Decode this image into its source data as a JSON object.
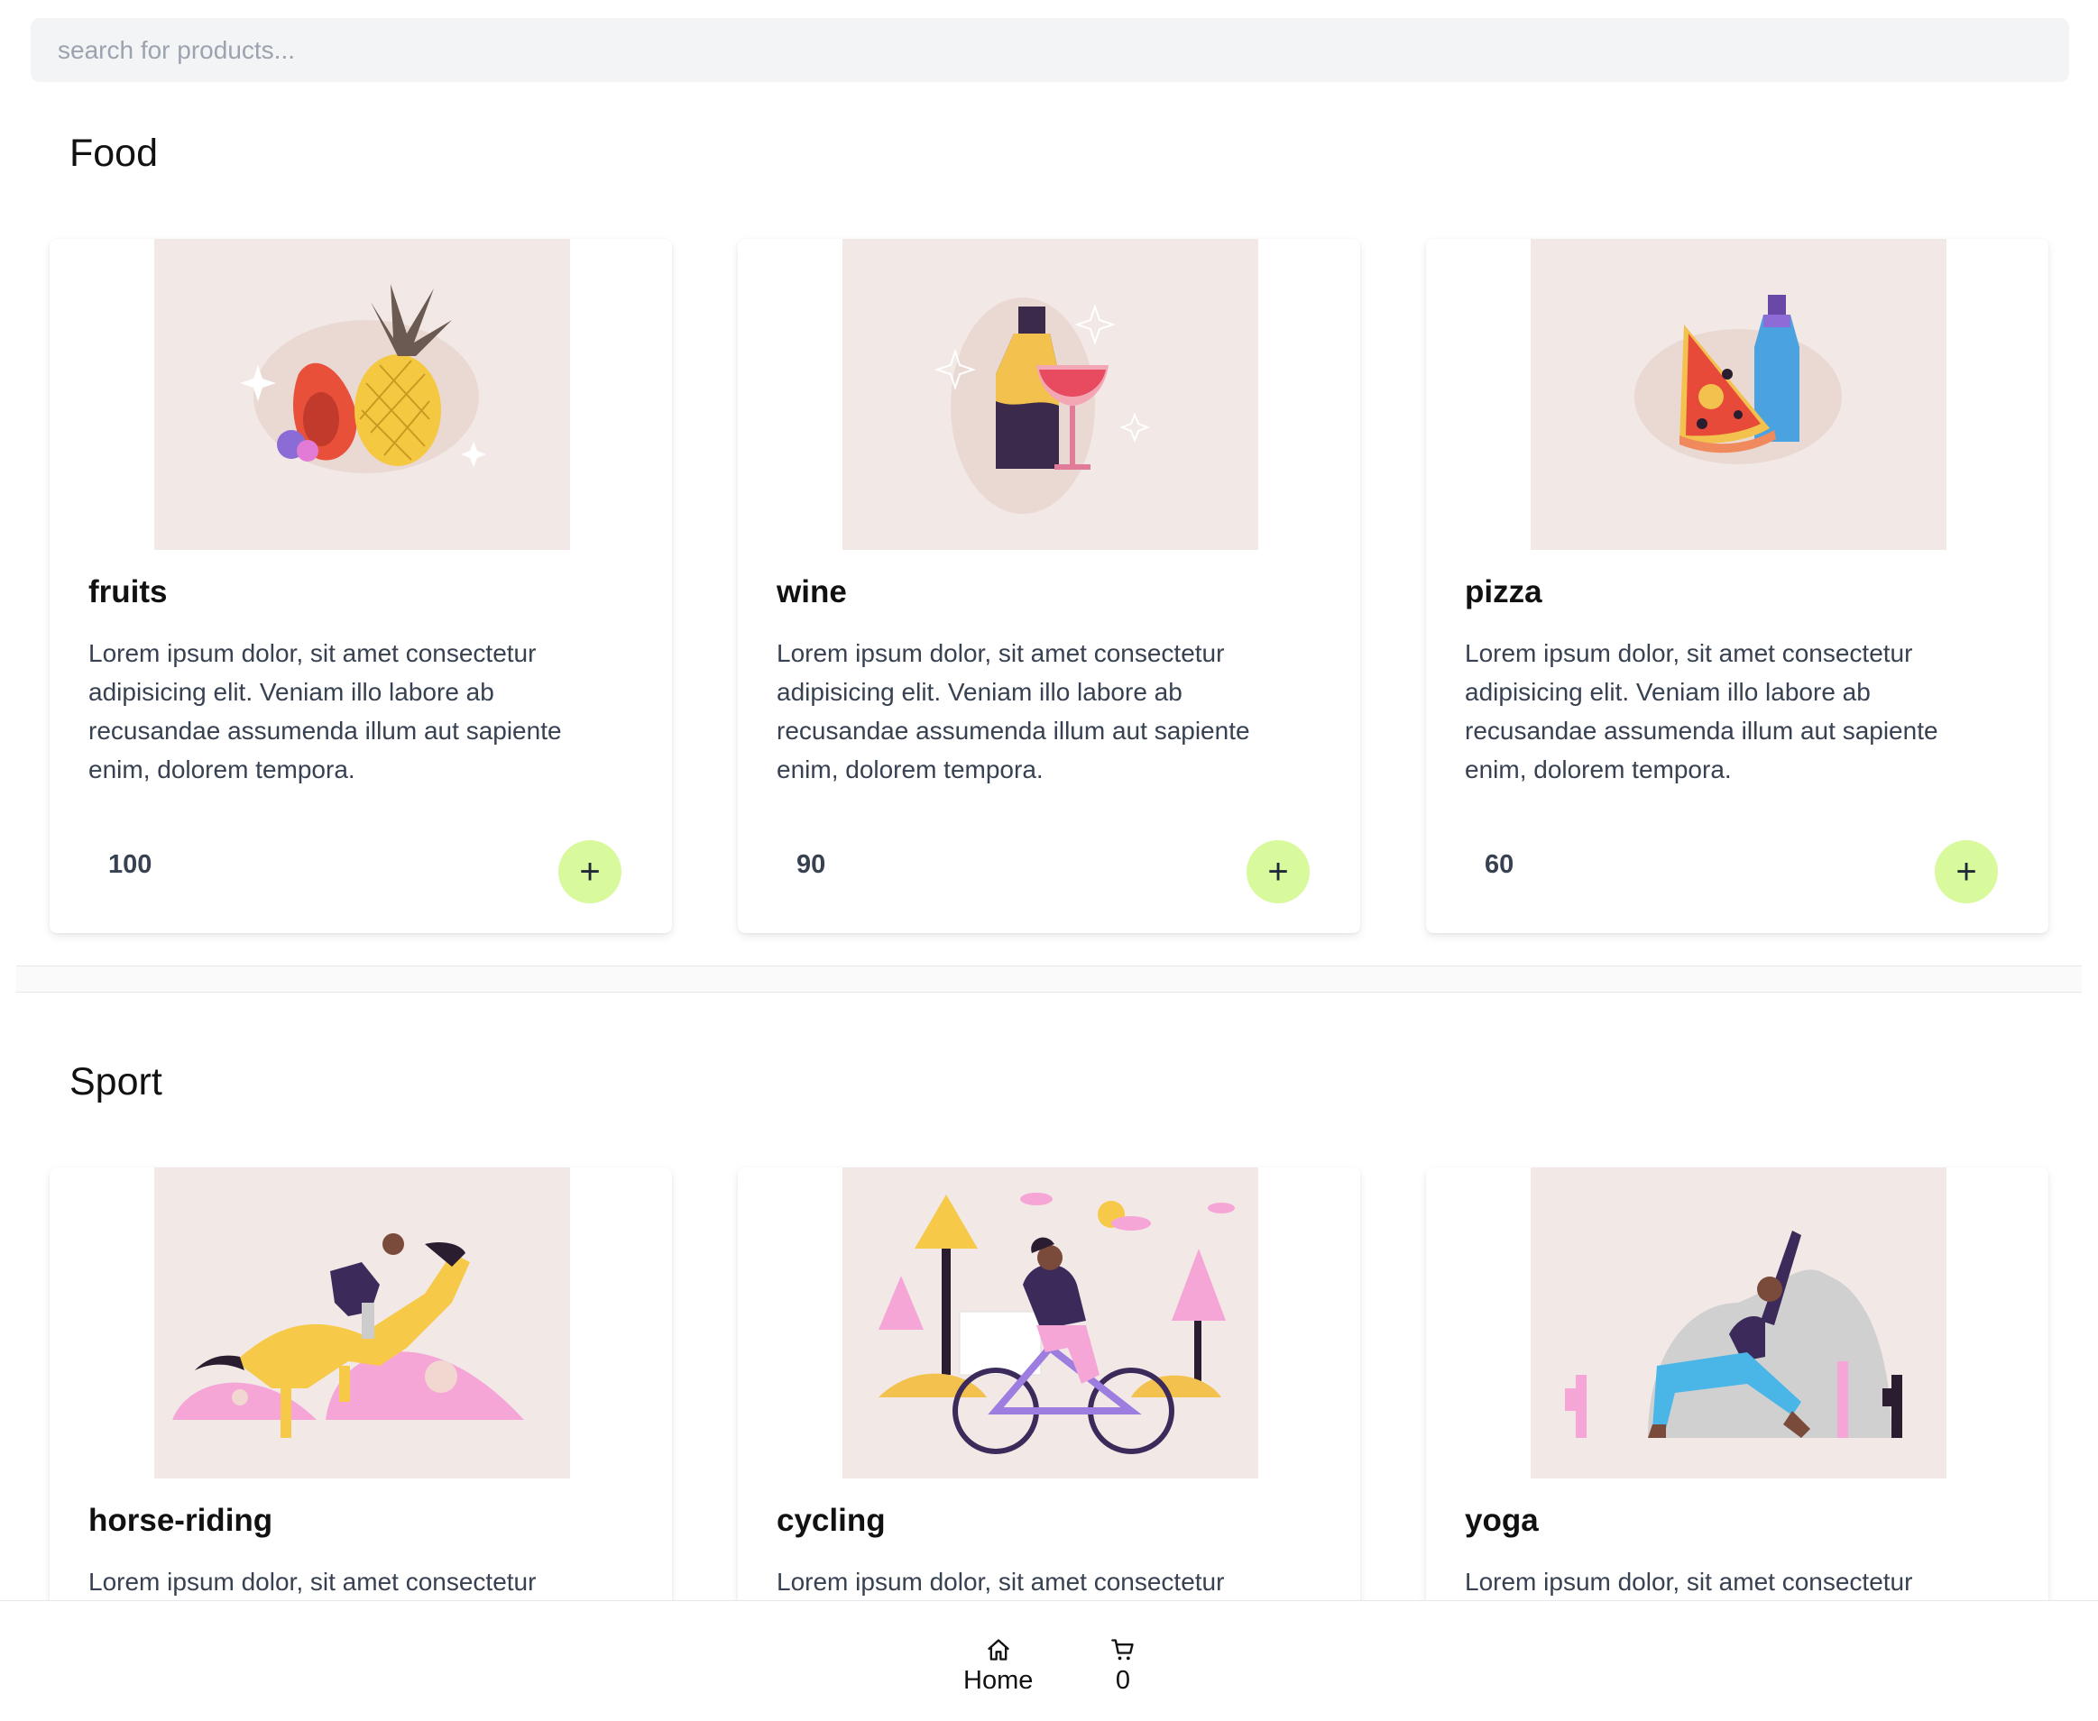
{
  "search": {
    "placeholder": "search for products..."
  },
  "sections": [
    {
      "title": "Food",
      "products": [
        {
          "name": "fruits",
          "description": "Lorem ipsum dolor, sit amet consectetur adipisicing elit. Veniam illo labore ab recusandae assumenda illum aut sapiente enim, dolorem tempora.",
          "price": "100",
          "add_label": "+"
        },
        {
          "name": "wine",
          "description": "Lorem ipsum dolor, sit amet consectetur adipisicing elit. Veniam illo labore ab recusandae assumenda illum aut sapiente enim, dolorem tempora.",
          "price": "90",
          "add_label": "+"
        },
        {
          "name": "pizza",
          "description": "Lorem ipsum dolor, sit amet consectetur adipisicing elit. Veniam illo labore ab recusandae assumenda illum aut sapiente enim, dolorem tempora.",
          "price": "60",
          "add_label": "+"
        }
      ]
    },
    {
      "title": "Sport",
      "products": [
        {
          "name": "horse-riding",
          "description": "Lorem ipsum dolor, sit amet consectetur"
        },
        {
          "name": "cycling",
          "description": "Lorem ipsum dolor, sit amet consectetur"
        },
        {
          "name": "yoga",
          "description": "Lorem ipsum dolor, sit amet consectetur"
        }
      ]
    }
  ],
  "nav": {
    "home": {
      "label": "Home",
      "icon": "home-icon"
    },
    "cart": {
      "count": "0",
      "icon": "cart-icon"
    }
  },
  "colors": {
    "add_button": "#d9f99d",
    "image_background": "#f2e9e7",
    "search_background": "#f3f4f6"
  }
}
